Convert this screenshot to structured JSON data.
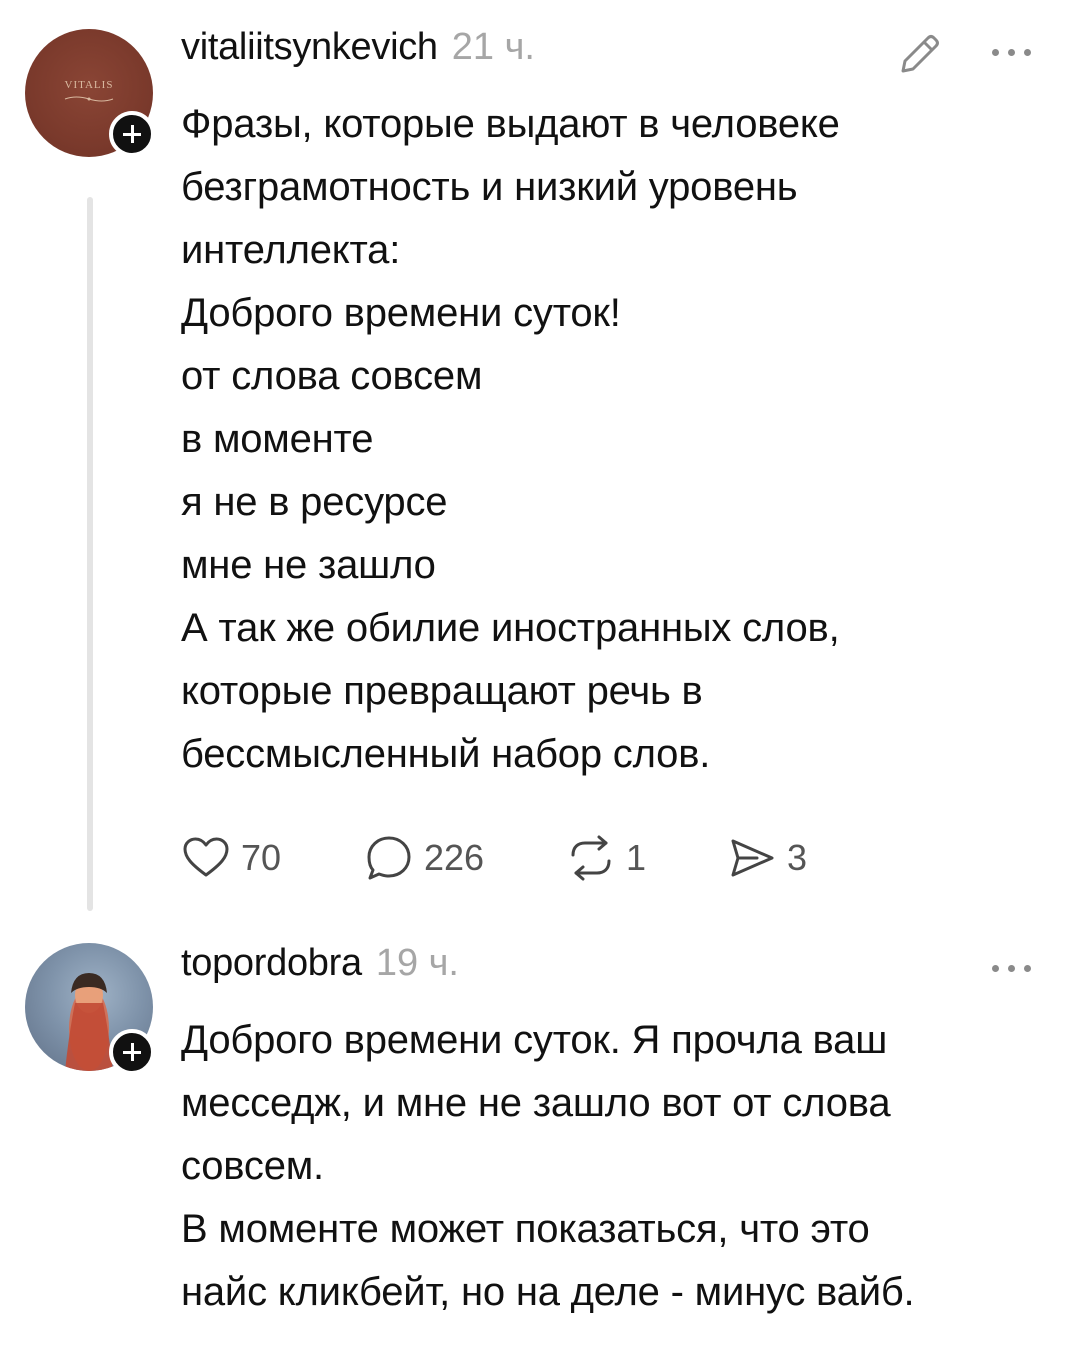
{
  "posts": [
    {
      "username": "vitaliitsynkevich",
      "timestamp": "21 ч.",
      "avatar_logo": "VITALIS",
      "avatar_color": "#7b3a2c",
      "lines": [
        "Фразы, которые выдают в человеке",
        "безграмотность и низкий уровень",
        "интеллекта:",
        "Доброго времени суток!",
        "от слова совсем",
        "в моменте",
        "я не в ресурсе",
        "мне не зашло",
        "А так же обилие иностранных слов,",
        "которые превращают речь в",
        "бессмысленный набор слов."
      ],
      "likes": "70",
      "comments": "226",
      "reposts": "1",
      "shares": "3",
      "icons": [
        "edit-icon",
        "more-icon",
        "heart-icon",
        "comment-icon",
        "repost-icon",
        "share-icon",
        "plus-icon"
      ]
    },
    {
      "username": "topordobra",
      "timestamp": "19 ч.",
      "lines": [
        "Доброго времени суток. Я прочла ваш",
        "месседж, и мне не зашло вот от слова",
        "совсем.",
        "В моменте может показаться, что это",
        "найс кликбейт, но на деле - минус вайб."
      ],
      "icons": [
        "more-icon",
        "plus-icon"
      ]
    }
  ],
  "colors": {
    "text": "#111111",
    "muted": "#a6a6a6",
    "thread_line": "#e4e4e4",
    "badge": "#111111"
  }
}
